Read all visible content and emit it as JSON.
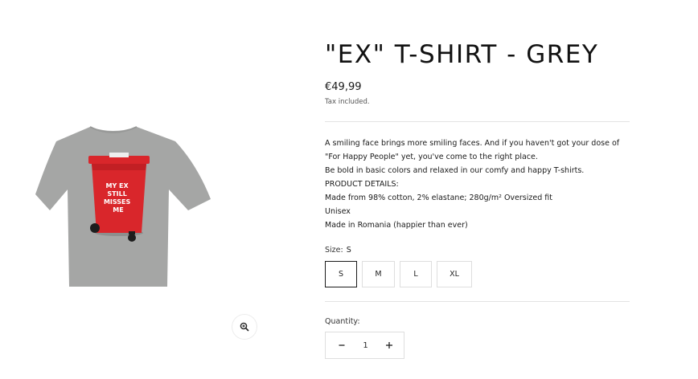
{
  "product": {
    "title": "\"EX\" T-SHIRT - GREY",
    "price": "€49,99",
    "tax_note": "Tax included.",
    "image_print_text": [
      "MY EX",
      "STILL",
      "MISSES",
      "ME"
    ],
    "description_lines": [
      "A smiling face brings more smiling faces. And if you haven't got your dose of",
      "\"For Happy People\" yet, you've come to the right place.",
      "Be bold in basic colors and relaxed in our comfy and happy T-shirts.",
      "PRODUCT DETAILS:",
      "Made from 98% cotton, 2% elastane; 280g/m² Oversized fit",
      "Unisex",
      "Made in Romania (happier than ever)"
    ]
  },
  "size": {
    "label": "Size:",
    "selected": "S",
    "options": [
      "S",
      "M",
      "L",
      "XL"
    ]
  },
  "quantity": {
    "label": "Quantity:",
    "value": "1",
    "decrement_icon": "minus-icon",
    "increment_icon": "plus-icon"
  },
  "media": {
    "zoom_icon": "zoom-in-icon"
  },
  "colors": {
    "shirt": "#a5a6a5",
    "bin": "#d9262b",
    "text": "#1a1a1a",
    "border": "#dedede"
  }
}
